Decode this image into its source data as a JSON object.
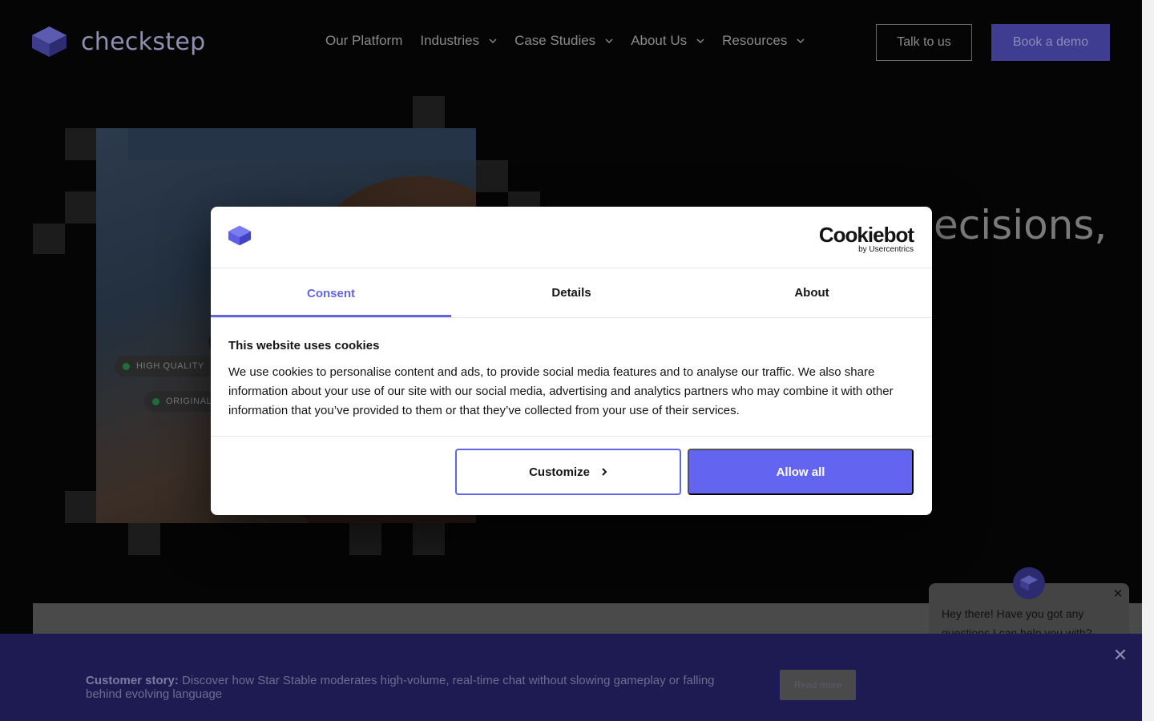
{
  "header": {
    "logo_text": "checkstep",
    "nav": [
      {
        "label": "Our Platform",
        "has_dropdown": false
      },
      {
        "label": "Industries",
        "has_dropdown": true
      },
      {
        "label": "Case Studies",
        "has_dropdown": true
      },
      {
        "label": "About Us",
        "has_dropdown": true
      },
      {
        "label": "Resources",
        "has_dropdown": true
      }
    ],
    "talk_label": "Talk to us",
    "demo_label": "Book a demo"
  },
  "hero": {
    "heading_fragment": "ecisions,",
    "tags": [
      "HIGH QUALITY",
      "ORIGINAL"
    ]
  },
  "cookie_dialog": {
    "provider_name": "Cookiebot",
    "provider_sub": "by Usercentrics",
    "tabs": [
      "Consent",
      "Details",
      "About"
    ],
    "active_tab": "Consent",
    "title": "This website uses cookies",
    "text": "We use cookies to personalise content and ads, to provide social media features and to analyse our traffic. We also share information about your use of our site with our social media, advertising and analytics partners who may combine it with other information that you’ve provided to them or that they’ve collected from your use of their services.",
    "customize_label": "Customize",
    "allow_label": "Allow all"
  },
  "chat": {
    "message": "Hey there! Have you got any questions I can help you with?"
  },
  "banner": {
    "lead": "Customer story:",
    "text": "Discover how Star Stable moderates high-volume, real-time chat without slowing gameplay or falling behind evolving language",
    "button_label": "Read more"
  },
  "colors": {
    "accent": "#6364e6",
    "brand_dark": "#3f3d91",
    "banner_bg": "#1e1b52"
  }
}
